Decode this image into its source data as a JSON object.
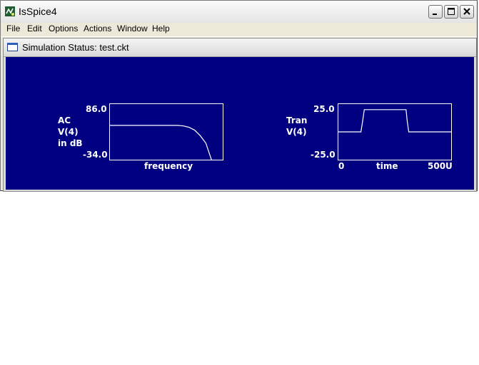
{
  "window": {
    "title": "IsSpice4"
  },
  "icons": {
    "app": "isspice-app-icon",
    "minimize": "minimize-icon",
    "maximize": "maximize-icon",
    "close": "close-icon",
    "child": "window-icon"
  },
  "menu": {
    "file": "File",
    "edit": "Edit",
    "options": "Options",
    "actions": "Actions",
    "window": "Window",
    "help": "Help"
  },
  "status": {
    "title": "Simulation Status: test.ckt",
    "background_color": "#000080",
    "trace_color": "#ffffff",
    "ac": {
      "label_line1": "AC",
      "label_line2": "V(4)",
      "label_line3": "in dB",
      "y_max": "86.0",
      "y_min": "-34.0",
      "x_label": "frequency"
    },
    "tran": {
      "label_line1": "Tran",
      "label_line2": "V(4)",
      "y_max": "25.0",
      "y_min": "-25.0",
      "x_start": "0",
      "x_label": "time",
      "x_end": "500U"
    }
  },
  "chart_data": [
    {
      "type": "line",
      "xlabel": "frequency",
      "ylabel": "AC V(4) in dB",
      "ylim": [
        -34.0,
        86.0
      ],
      "x_scale": "relative",
      "x": [
        0,
        0.1,
        0.2,
        0.3,
        0.4,
        0.5,
        0.6,
        0.65,
        0.7,
        0.75,
        0.8,
        0.85,
        0.9
      ],
      "y": [
        40,
        40,
        40,
        40,
        40,
        40,
        40,
        39,
        36,
        30,
        18,
        2,
        -34
      ]
    },
    {
      "type": "line",
      "xlabel": "time",
      "ylabel": "Tran V(4)",
      "xlim": [
        0,
        500
      ],
      "ylim": [
        -25.0,
        25.0
      ],
      "x": [
        0,
        100,
        108,
        115,
        150,
        200,
        250,
        300,
        305,
        312,
        320,
        400,
        500
      ],
      "y": [
        0,
        0,
        10,
        20,
        20,
        20,
        20,
        20,
        10,
        0,
        0,
        0,
        0
      ]
    }
  ]
}
